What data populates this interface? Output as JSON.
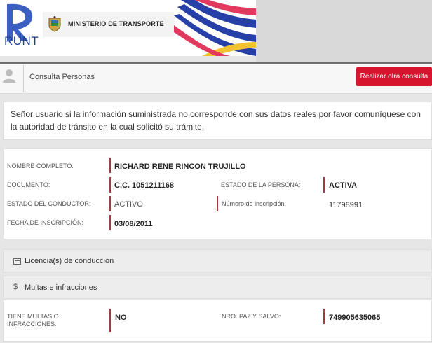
{
  "header": {
    "runt_logo_text": "RUNT",
    "ministry_name": "MINISTERIO DE TRANSPORTE"
  },
  "consulta": {
    "title": "Consulta Personas",
    "button_label": "Realizar otra consulta"
  },
  "notice": {
    "text": "Señor usuario si la información suministrada no corresponde con sus datos reales por favor comuníquese con la autoridad de tránsito en la cual solicitó su trámite."
  },
  "person": {
    "nombre_label": "NOMBRE COMPLETO:",
    "nombre_value": "RICHARD RENE RINCON TRUJILLO",
    "documento_label": "DOCUMENTO:",
    "documento_value": "C.C. 1051211168",
    "estado_persona_label": "ESTADO DE LA PERSONA:",
    "estado_persona_value": "ACTIVA",
    "estado_conductor_label": "ESTADO DEL CONDUCTOR:",
    "estado_conductor_value": "ACTIVO",
    "inscripcion_num_label": "Número de inscripción:",
    "inscripcion_num_value": "11798991",
    "fecha_label": "FECHA DE INSCRIPCIÓN:",
    "fecha_value": "03/08/2011"
  },
  "sections": {
    "licencias": "Licencia(s) de conducción",
    "multas": "Multas e infracciones",
    "multas_icon_glyph": "$"
  },
  "multas": {
    "tiene_label": "TIENE MULTAS O INFRACCIONES:",
    "tiene_value": "NO",
    "paz_label": "NRO. PAZ Y SALVO:",
    "paz_value": "749905635065"
  },
  "colors": {
    "accent_red": "#d7142d",
    "runt_blue": "#1f3d8a",
    "label_bar": "#a13a3a"
  }
}
